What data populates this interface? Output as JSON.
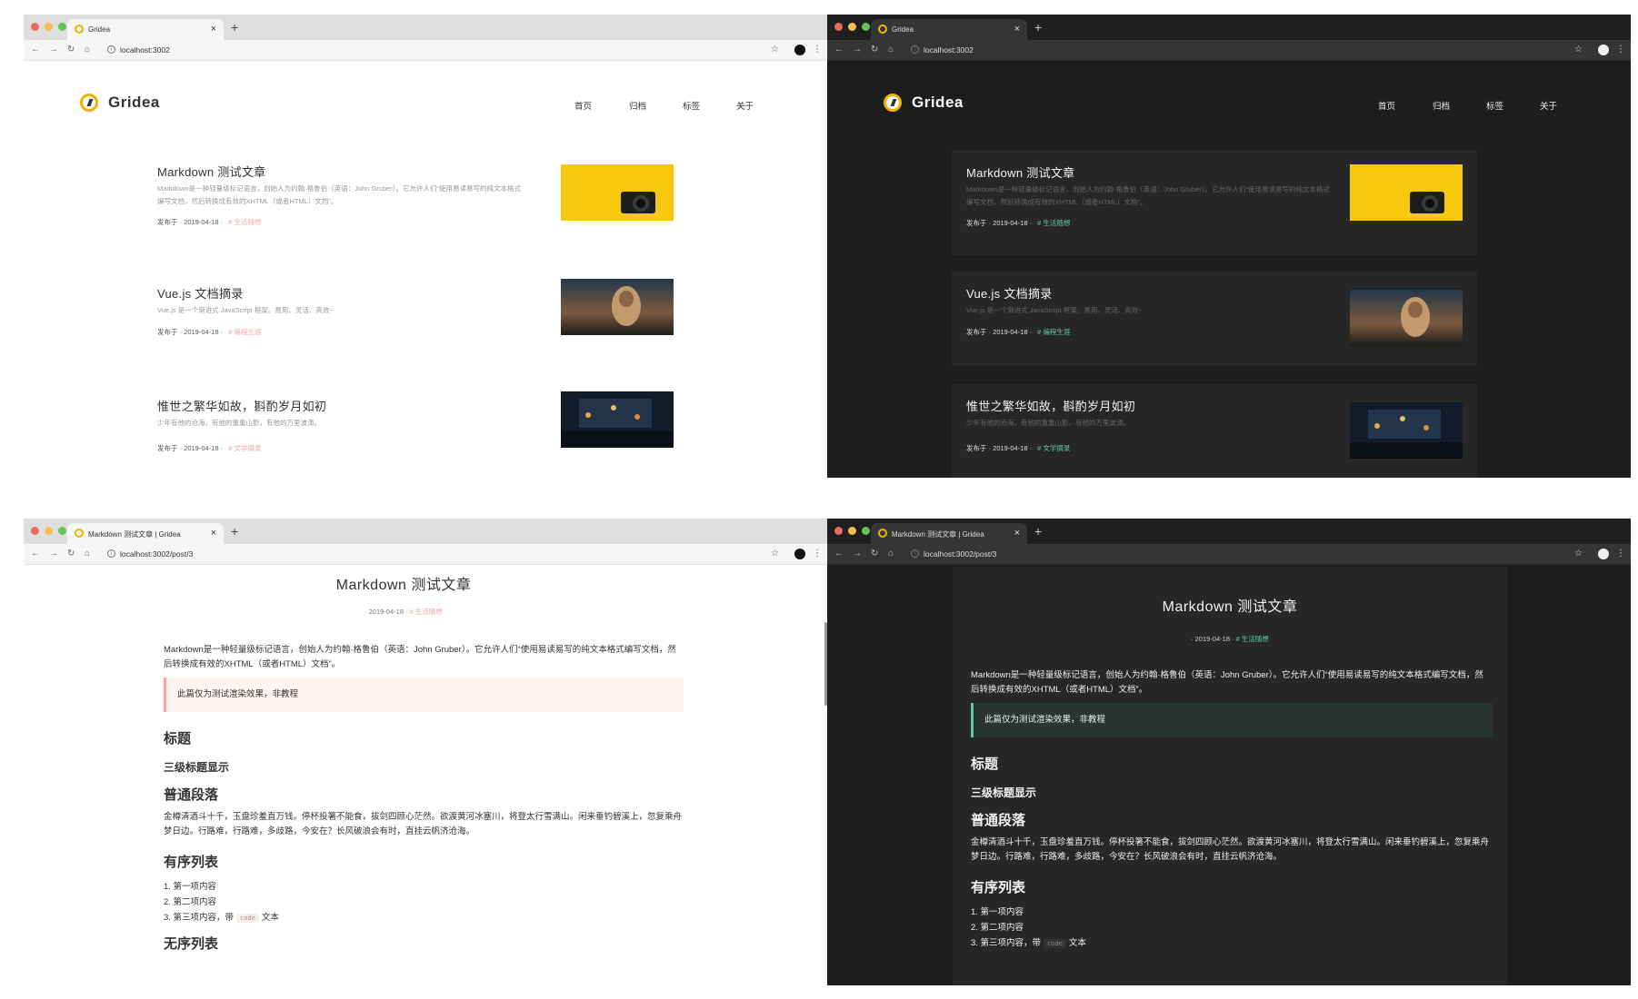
{
  "traffic_lights": [
    "#ee6a5f",
    "#f5be4f",
    "#62c655"
  ],
  "home": {
    "tab_title": "Gridea",
    "url": "localhost:3002",
    "brand": "Gridea",
    "menu": [
      "首页",
      "归档",
      "标签",
      "关于"
    ],
    "posts": [
      {
        "title": "Markdown 测试文章",
        "abstract": "Markdown是一种轻量级标记语言，创始人为约翰·格鲁伯（英语：John Gruber）。它允许人们“使用易读易写的纯文本格式编写文档，然后转换成有效的XHTML（或者HTML）文档”。",
        "meta": "发布于 · 2019-04-18 ·",
        "tag": "# 生活随想",
        "image": "yellow-camera"
      },
      {
        "title": "Vue.js 文档摘录",
        "abstract": "Vue.js 是一个渐进式 JavaScript 框架。易用、灵活、高效~",
        "meta": "发布于 · 2019-04-18 ·",
        "tag": "# 编程生涯",
        "image": "sunset-person"
      },
      {
        "title": "惟世之繁华如故，斟酌岁月如初",
        "abstract": "少年有他的沧海，有他的重重山影，有他的万里波涛。",
        "meta": "发布于 · 2019-04-18 ·",
        "tag": "# 文学摘录",
        "image": "night-street"
      }
    ]
  },
  "detail": {
    "tab_title": "Markdown 测试文章 | Gridea",
    "url": "localhost:3002/post/3",
    "title": "Markdown 测试文章",
    "date": "· 2019-04-18 ·",
    "tag": "# 生活随想",
    "intro": "Markdown是一种轻量级标记语言，创始人为约翰·格鲁伯（英语：John Gruber）。它允许人们“使用易读易写的纯文本格式编写文档，然后转换成有效的XHTML（或者HTML）文档”。",
    "quote": "此篇仅为测试渲染效果，非教程",
    "h_title": "标题",
    "h_level3": "三级标题显示",
    "h_para": "普通段落",
    "para": "金樽清酒斗十千，玉盘珍羞直万钱。停杯投箸不能食，拔剑四顾心茫然。欲渡黄河冰塞川，将登太行雪满山。闲来垂钓碧溪上，忽复乘舟梦日边。行路难，行路难，多歧路，今安在？长风破浪会有时，直挂云帆济沧海。",
    "h_ordered": "有序列表",
    "list": [
      "1. 第一项内容",
      "2. 第二项内容",
      "3. 第三项内容，带"
    ],
    "code": "code",
    "list_tail": "文本",
    "h_unordered": "无序列表"
  }
}
